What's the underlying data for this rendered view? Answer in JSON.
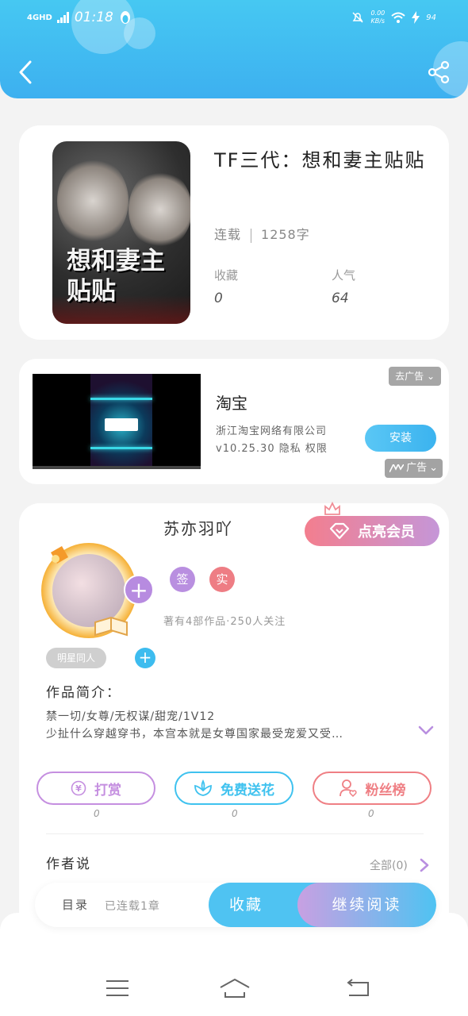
{
  "status_bar": {
    "network": "4GHD",
    "time": "01:18",
    "speed_top": "0.00",
    "speed_bottom": "KB/s",
    "battery": "94"
  },
  "header": {
    "bg_color": "#46c8f2",
    "back_icon": "chevron-left-icon",
    "share_icon": "share-icon"
  },
  "book": {
    "cover_title": "想和妻主贴贴",
    "title": "TF三代：想和妻主贴贴",
    "status": "连载",
    "word_count": "1258字",
    "favorites_label": "收藏",
    "favorites_value": "0",
    "popularity_label": "人气",
    "popularity_value": "64"
  },
  "ad": {
    "close_label": "去广告",
    "app_name": "淘宝",
    "company": "浙江淘宝网络有限公司",
    "version_info": "v10.25.30  隐私  权限",
    "install_label": "安装",
    "ad_tag": "广告"
  },
  "author": {
    "name": "苏亦羽吖",
    "vip_label": "点亮会员",
    "badge_sign": "签",
    "badge_real": "实",
    "stats": "著有4部作品·250人关注",
    "tag": "明星同人",
    "intro_label": "作品简介：",
    "intro_line1": "禁一切/女尊/无权谋/甜宠/1V12",
    "intro_line2": "少扯什么穿越穿书，本宫本就是女尊国家最受宠爱又受…",
    "actions": [
      {
        "label": "打赏",
        "count": "0",
        "color": "#c58fe0"
      },
      {
        "label": "免费送花",
        "count": "0",
        "color": "#3fc2ef"
      },
      {
        "label": "粉丝榜",
        "count": "0",
        "color": "#ef7f84"
      }
    ],
    "author_says_label": "作者说",
    "author_says_all": "全部(0)"
  },
  "bottom_bar": {
    "toc_label": "目录",
    "toc_status": "已连载1章",
    "favorite_label": "收藏",
    "read_label": "继续阅读"
  },
  "system_nav": {
    "menu_icon": "menu-icon",
    "home_icon": "home-icon",
    "back_icon": "back-icon"
  }
}
